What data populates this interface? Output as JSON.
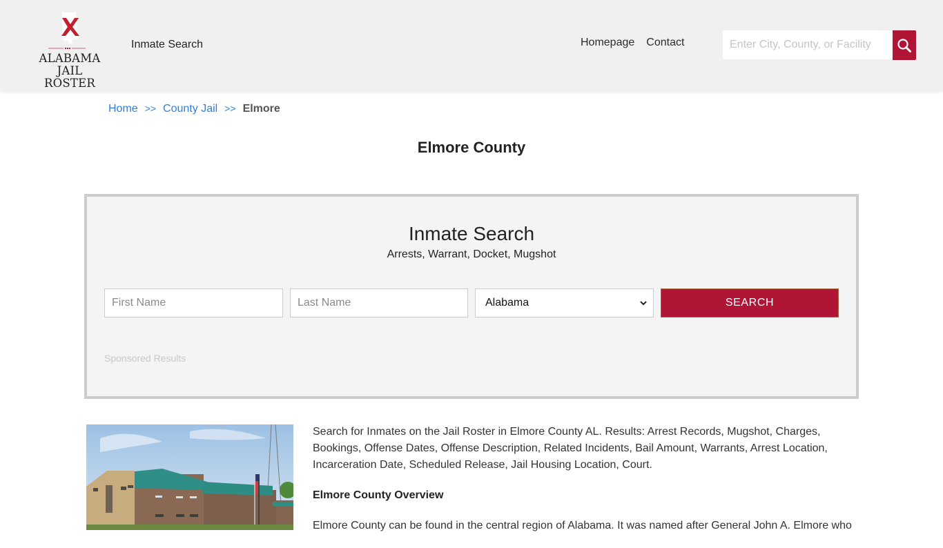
{
  "header": {
    "logo": {
      "line1": "ALABAMA",
      "line2": "JAIL ROSTER",
      "accent_color": "#c21f2f"
    },
    "nav_left": "Inmate Search",
    "nav_right": [
      "Homepage",
      "Contact"
    ],
    "search": {
      "placeholder": "Enter City, County, or Facility",
      "icon": "search-icon",
      "button_color": "#b01536"
    }
  },
  "breadcrumb": {
    "items": [
      "Home",
      "County Jail"
    ],
    "separator": ">>",
    "current": "Elmore"
  },
  "page_title": "Elmore County",
  "search_panel": {
    "title": "Inmate Search",
    "subtitle": "Arrests, Warrant, Docket, Mugshot",
    "first_name_placeholder": "First Name",
    "last_name_placeholder": "Last Name",
    "state_selected": "Alabama",
    "button_label": "SEARCH",
    "sponsored_label": "Sponsored Results"
  },
  "content": {
    "image_alt": "Elmore County Jail building",
    "intro": "Search for Inmates on the Jail Roster in Elmore County AL. Results: Arrest Records, Mugshot, Charges, Bookings, Offense Dates, Offense Description, Related Incidents, Bail Amount, Warrants, Arrest Location, Incarceration Date, Scheduled Release, Jail Housing Location, Court.",
    "overview_heading": "Elmore County Overview",
    "overview_text": "Elmore County can be found in the central region of Alabama. It was named after General John A. Elmore who"
  }
}
